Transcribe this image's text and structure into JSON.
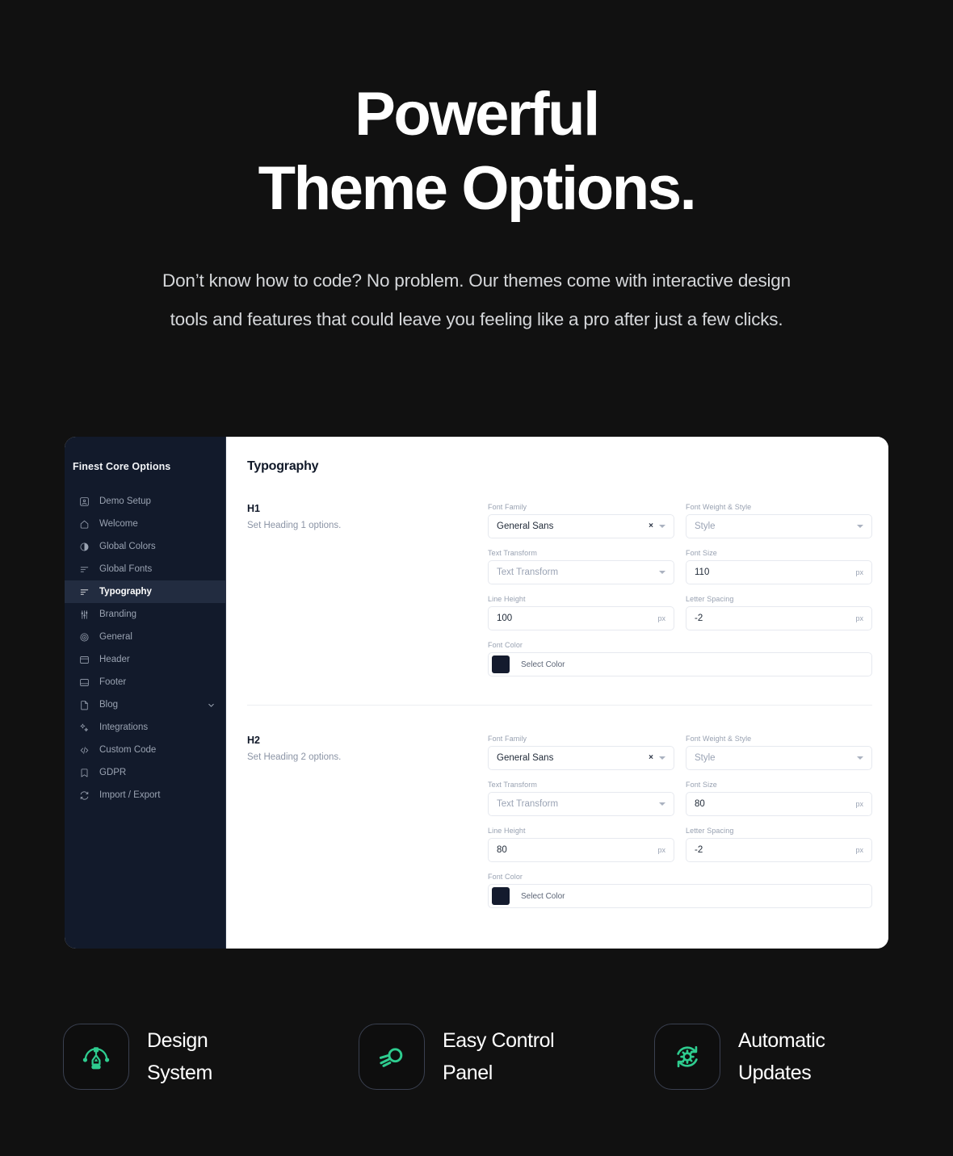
{
  "hero": {
    "headline_line1": "Powerful",
    "headline_line2": "Theme Options.",
    "subtitle": "Don’t know how to code? No problem. Our themes come with interactive design tools and features that could leave you feeling like a pro after just a few clicks."
  },
  "panel": {
    "sidebar": {
      "title": "Finest Core Options",
      "items": [
        {
          "label": "Demo Setup",
          "icon": "image-box-icon",
          "active": false,
          "expandable": false
        },
        {
          "label": "Welcome",
          "icon": "home-icon",
          "active": false,
          "expandable": false
        },
        {
          "label": "Global Colors",
          "icon": "contrast-icon",
          "active": false,
          "expandable": false
        },
        {
          "label": "Global Fonts",
          "icon": "text-lines-icon",
          "active": false,
          "expandable": false
        },
        {
          "label": "Typography",
          "icon": "text-lines-icon",
          "active": true,
          "expandable": false
        },
        {
          "label": "Branding",
          "icon": "sliders-icon",
          "active": false,
          "expandable": false
        },
        {
          "label": "General",
          "icon": "target-icon",
          "active": false,
          "expandable": false
        },
        {
          "label": "Header",
          "icon": "header-layout-icon",
          "active": false,
          "expandable": false
        },
        {
          "label": "Footer",
          "icon": "footer-layout-icon",
          "active": false,
          "expandable": false
        },
        {
          "label": "Blog",
          "icon": "document-icon",
          "active": false,
          "expandable": true
        },
        {
          "label": "Integrations",
          "icon": "sparkle-icon",
          "active": false,
          "expandable": false
        },
        {
          "label": "Custom Code",
          "icon": "code-icon",
          "active": false,
          "expandable": false
        },
        {
          "label": "GDPR",
          "icon": "bookmark-icon",
          "active": false,
          "expandable": false
        },
        {
          "label": "Import / Export",
          "icon": "sync-icon",
          "active": false,
          "expandable": false
        }
      ]
    },
    "content": {
      "title": "Typography",
      "sections": [
        {
          "heading": "H1",
          "description": "Set Heading 1 options.",
          "fields": {
            "font_family": {
              "label": "Font Family",
              "value": "General Sans",
              "clear": "×"
            },
            "font_weight_style": {
              "label": "Font Weight & Style",
              "placeholder": "Style"
            },
            "text_transform": {
              "label": "Text Transform",
              "placeholder": "Text Transform"
            },
            "font_size": {
              "label": "Font Size",
              "value": "110",
              "unit": "px"
            },
            "line_height": {
              "label": "Line Height",
              "value": "100",
              "unit": "px"
            },
            "letter_spacing": {
              "label": "Letter Spacing",
              "value": "-2",
              "unit": "px"
            },
            "font_color": {
              "label": "Font Color",
              "value": "Select Color",
              "swatch": "#141b2e"
            }
          }
        },
        {
          "heading": "H2",
          "description": "Set Heading 2 options.",
          "fields": {
            "font_family": {
              "label": "Font Family",
              "value": "General Sans",
              "clear": "×"
            },
            "font_weight_style": {
              "label": "Font Weight & Style",
              "placeholder": "Style"
            },
            "text_transform": {
              "label": "Text Transform",
              "placeholder": "Text Transform"
            },
            "font_size": {
              "label": "Font Size",
              "value": "80",
              "unit": "px"
            },
            "line_height": {
              "label": "Line Height",
              "value": "80",
              "unit": "px"
            },
            "letter_spacing": {
              "label": "Letter Spacing",
              "value": "-2",
              "unit": "px"
            },
            "font_color": {
              "label": "Font Color",
              "value": "Select Color",
              "swatch": "#141b2e"
            }
          }
        }
      ]
    }
  },
  "features": [
    {
      "label": "Design\nSystem",
      "icon": "pen-tool-icon"
    },
    {
      "label": "Easy Control\nPanel",
      "icon": "rocket-icon"
    },
    {
      "label": "Automatic\nUpdates",
      "icon": "gear-refresh-icon"
    }
  ],
  "colors": {
    "background": "#111111",
    "panel_bg": "#ffffff",
    "sidebar_bg": "#121a2b",
    "sidebar_active": "#222c40",
    "accent_green": "#2ecc8f",
    "text_primary": "#ffffff",
    "text_muted": "#d5d7da"
  }
}
